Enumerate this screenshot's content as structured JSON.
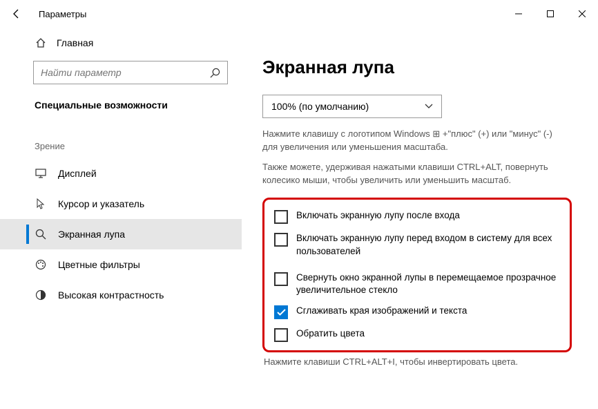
{
  "window": {
    "title": "Параметры"
  },
  "sidebar": {
    "home_label": "Главная",
    "search_placeholder": "Найти параметр",
    "section": "Специальные возможности",
    "group_label": "Зрение",
    "items": [
      {
        "label": "Дисплей"
      },
      {
        "label": "Курсор и указатель"
      },
      {
        "label": "Экранная лупа"
      },
      {
        "label": "Цветные фильтры"
      },
      {
        "label": "Высокая контрастность"
      }
    ]
  },
  "content": {
    "heading": "Экранная лупа",
    "zoom_level": "100% (по умолчанию)",
    "hint1": "Нажмите клавишу с логотипом Windows ⊞ +\"плюс\" (+) или \"минус\" (-) для увеличения или уменьшения масштаба.",
    "hint2": "Также можете, удерживая нажатыми клавиши CTRL+ALT, повернуть колесико мыши, чтобы увеличить или уменьшить масштаб.",
    "checks": [
      {
        "label": "Включать экранную лупу после входа",
        "checked": false
      },
      {
        "label": "Включать экранную лупу перед входом в систему для всех пользователей",
        "checked": false
      },
      {
        "label": "Свернуть окно экранной лупы в перемещаемое прозрачное увеличительное стекло",
        "checked": false
      },
      {
        "label": "Сглаживать края изображений и текста",
        "checked": true
      },
      {
        "label": "Обратить цвета",
        "checked": false
      }
    ],
    "footer_hint": "Нажмите клавиши CTRL+ALT+I, чтобы инвертировать цвета."
  }
}
